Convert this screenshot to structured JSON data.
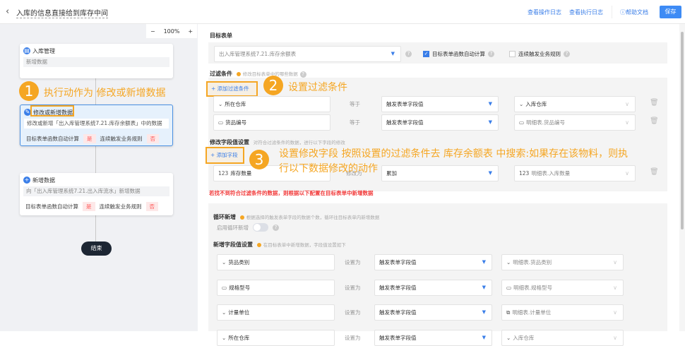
{
  "header": {
    "title": "入库的信息直接给到库存中间",
    "links": [
      "查看操作日志",
      "查看执行日志"
    ],
    "help": "帮助文档",
    "save": "保存"
  },
  "canvas": {
    "zoom": "100%",
    "minus": "−",
    "plus": "+",
    "nodes": [
      {
        "title": "入库管理",
        "desc": "新增数据"
      },
      {
        "title": "修改或新增数据",
        "desc": "修改或新增「出入库管理系统7.21.库存余额表」中的数据",
        "flag1": "目标表单函数自动计算",
        "v1": "是",
        "flag2": "连续触发业务规则",
        "v2": "否"
      },
      {
        "title": "新增数据",
        "desc": "向「出入库管理系统7.21.出入库流水」新增数据",
        "flag1": "目标表单函数自动计算",
        "v1": "是",
        "flag2": "连续触发业务规则",
        "v2": "否"
      }
    ],
    "end": "结束"
  },
  "annotations": {
    "a1": {
      "num": "1",
      "text": "执行动作为 修改或新增数据"
    },
    "a2": {
      "num": "2",
      "text": "设置过滤条件"
    },
    "a3": {
      "num": "3",
      "text": "设置修改字段 按照设置的过滤条件去 库存余额表 中搜索:如果存在该物料，则执行以下数据修改的动作"
    }
  },
  "target": {
    "label": "目标表单",
    "select": "出入库管理系统7.21.库存余额表",
    "auto_calc": "目标表单函数自动计算",
    "auto_calc_checked": true,
    "trigger": "连续触发业务规则",
    "trigger_checked": false
  },
  "filter": {
    "label": "过滤条件",
    "hint": "修改目标表单中的哪些数据",
    "add": "+ 添加过滤条件",
    "rows": [
      {
        "field": "所在仓库",
        "op": "等于",
        "mode": "触发表单字段值",
        "value": "入库仓库"
      },
      {
        "field": "货品编号",
        "op": "等于",
        "mode": "触发表单字段值",
        "value": "明细表.货品编号"
      }
    ]
  },
  "modify": {
    "label": "修改字段值设置",
    "hint": "对符合过滤条件的数据，进行以下字段的修改",
    "add": "+ 添加字段",
    "rows": [
      {
        "icon": "123",
        "field": "库存数量",
        "op": "修改为",
        "mode": "累加",
        "value": "明细表.入库数量"
      }
    ]
  },
  "warning": "若找不到符合过滤条件的数据，则根据以下配置在目标表单中新增数据",
  "loop": {
    "label": "循环新增",
    "hint": "根据选择的触发表单字段的数据个数，循环往目标表单内新增数据",
    "enable": "启用循环新增",
    "enabled": false
  },
  "insert": {
    "label": "新增字段值设置",
    "hint": "在目标表单中新增数据，字段值设置如下",
    "rows": [
      {
        "field": "货品类别",
        "op": "设置为",
        "mode": "触发表单字段值",
        "value": "明细表.货品类别"
      },
      {
        "field": "规格型号",
        "op": "设置为",
        "mode": "触发表单字段值",
        "value": "明细表.规格型号"
      },
      {
        "field": "计量单位",
        "op": "设置为",
        "mode": "触发表单字段值",
        "value": "明细表.计量单位"
      },
      {
        "field": "所在仓库",
        "op": "设置为",
        "mode": "触发表单字段值",
        "value": "入库仓库"
      }
    ]
  }
}
